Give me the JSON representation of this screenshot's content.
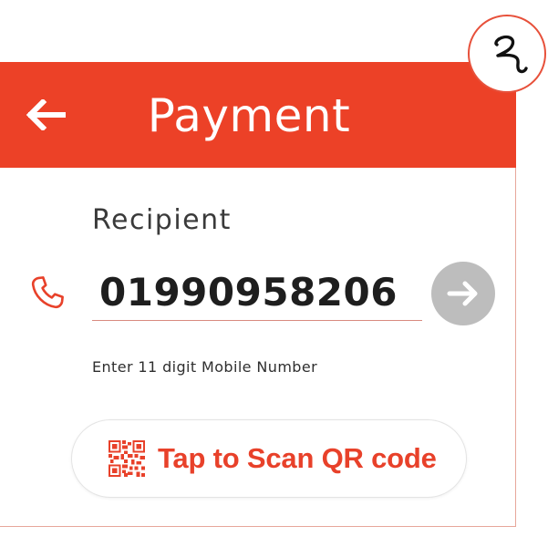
{
  "header": {
    "title": "Payment",
    "back_icon": "arrow-left-icon",
    "background_color": "#ec4127"
  },
  "logo": {
    "icon": "brand-logo-icon"
  },
  "recipient": {
    "label": "Recipient",
    "phone_icon": "phone-icon",
    "phone_value": "01990958206",
    "hint": "Enter 11 digit Mobile Number",
    "submit_icon": "arrow-right-icon",
    "submit_color": "#bdbdbd"
  },
  "scan": {
    "label": "Tap to Scan QR code",
    "icon": "qr-code-icon",
    "accent_color": "#e8412a"
  }
}
